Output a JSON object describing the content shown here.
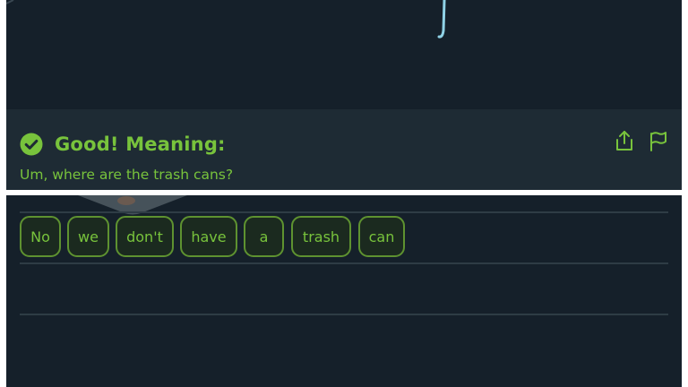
{
  "feedback": {
    "title": "Good! Meaning:",
    "meaning": "Um, where are the trash cans?",
    "status": "correct"
  },
  "icons": {
    "status": "check-circle-icon",
    "share": "share-icon",
    "report": "flag-icon"
  },
  "word_bank": [
    "No",
    "we",
    "don't",
    "have",
    "a",
    "trash",
    "can"
  ],
  "colors": {
    "background": "#15202a",
    "feedback_panel": "#1e2b34",
    "accent_green": "#78c33c",
    "tile_border": "#5e9230",
    "rule_line": "#2e3c45"
  }
}
